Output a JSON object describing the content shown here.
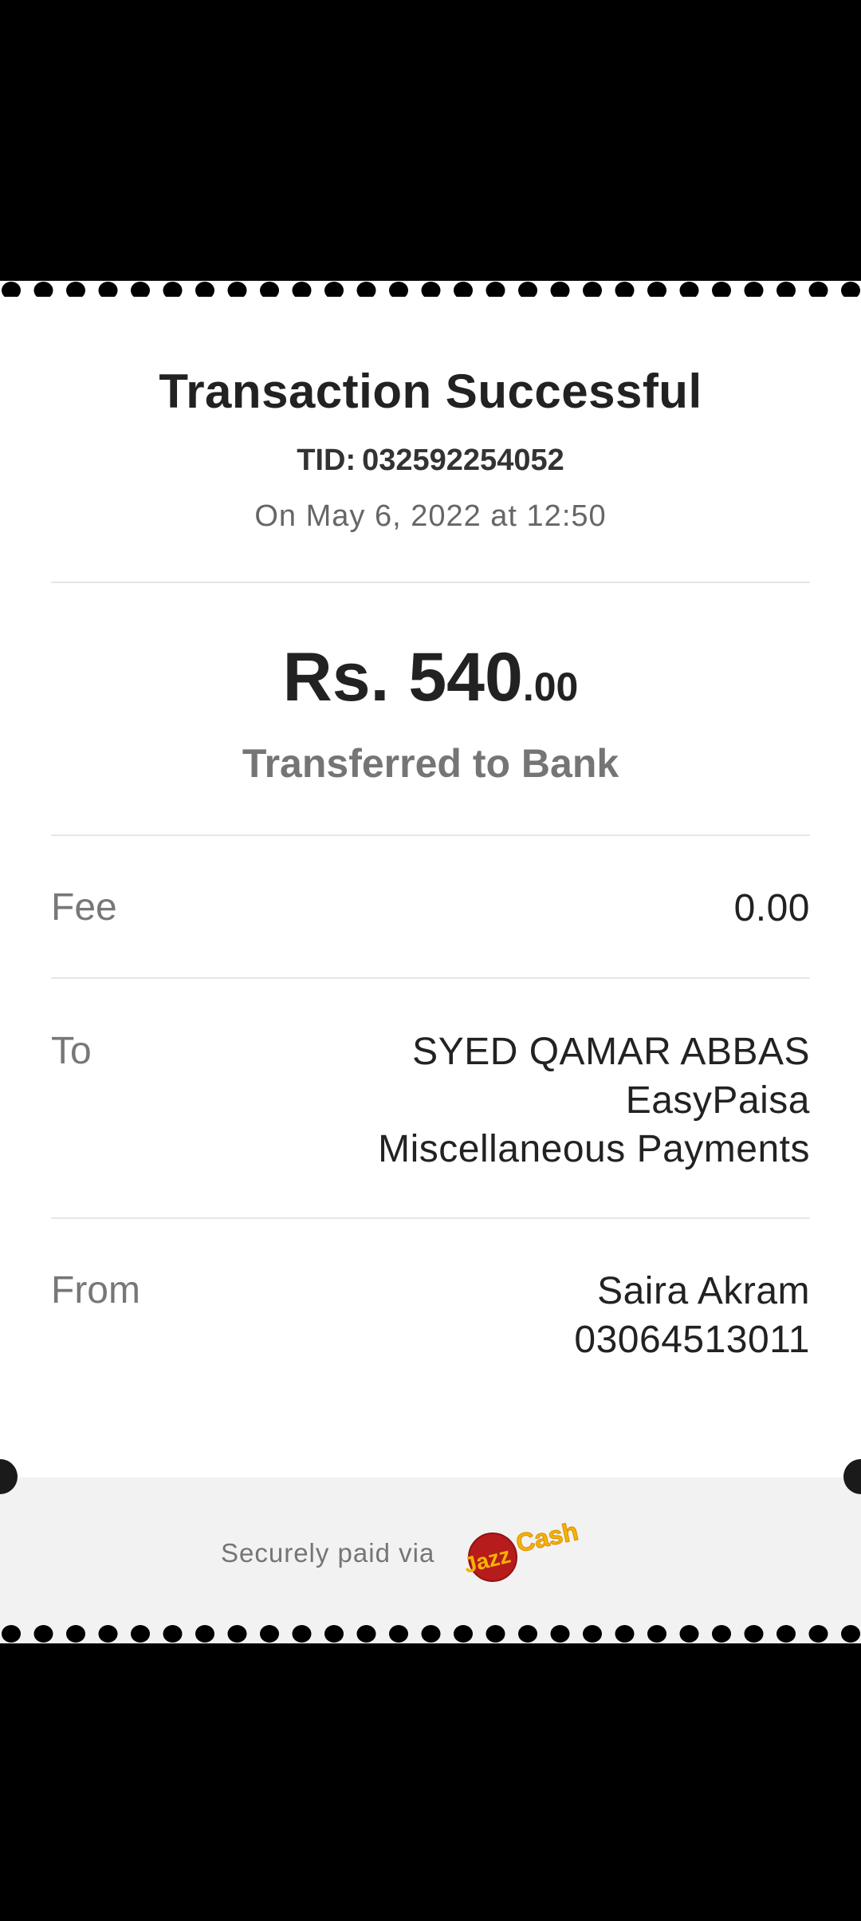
{
  "receipt": {
    "title": "Transaction Successful",
    "tid_label": "TID:",
    "tid_value": "032592254052",
    "datetime": "On May 6, 2022 at 12:50",
    "amount_main": "Rs. 540",
    "amount_decimal": ".00",
    "subtitle": "Transferred to Bank",
    "fee": {
      "label": "Fee",
      "value": "0.00"
    },
    "to": {
      "label": "To",
      "name": "SYED QAMAR ABBAS",
      "bank": "EasyPaisa",
      "purpose": "Miscellaneous Payments"
    },
    "from": {
      "label": "From",
      "name": "Saira Akram",
      "number": "03064513011"
    }
  },
  "footer": {
    "text": "Securely paid via",
    "logo_text_jazz": "Jazz",
    "logo_text_cash": "Cash"
  },
  "colors": {
    "background": "#000000",
    "card": "#ffffff",
    "footer": "#f2f2f2",
    "logo_red": "#b71c1c",
    "logo_yellow": "#f5b400"
  },
  "icons": {
    "logo": "jazzcash-logo"
  }
}
